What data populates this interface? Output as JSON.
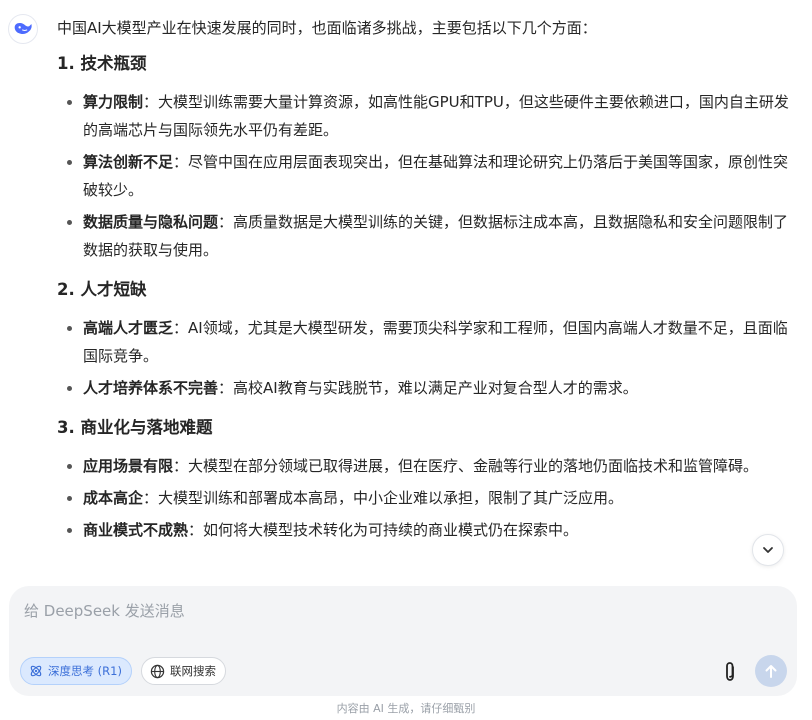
{
  "message": {
    "intro": "中国AI大模型产业在快速发展的同时，也面临诸多挑战，主要包括以下几个方面：",
    "sections": [
      {
        "title": "1. 技术瓶颈",
        "items": [
          {
            "label": "算力限制",
            "text": "：大模型训练需要大量计算资源，如高性能GPU和TPU，但这些硬件主要依赖进口，国内自主研发的高端芯片与国际领先水平仍有差距。"
          },
          {
            "label": "算法创新不足",
            "text": "：尽管中国在应用层面表现突出，但在基础算法和理论研究上仍落后于美国等国家，原创性突破较少。"
          },
          {
            "label": "数据质量与隐私问题",
            "text": "：高质量数据是大模型训练的关键，但数据标注成本高，且数据隐私和安全问题限制了数据的获取与使用。"
          }
        ]
      },
      {
        "title": "2. 人才短缺",
        "items": [
          {
            "label": "高端人才匮乏",
            "text": "：AI领域，尤其是大模型研发，需要顶尖科学家和工程师，但国内高端人才数量不足，且面临国际竞争。"
          },
          {
            "label": "人才培养体系不完善",
            "text": "：高校AI教育与实践脱节，难以满足产业对复合型人才的需求。"
          }
        ]
      },
      {
        "title": "3. 商业化与落地难题",
        "items": [
          {
            "label": "应用场景有限",
            "text": "：大模型在部分领域已取得进展，但在医疗、金融等行业的落地仍面临技术和监管障碍。"
          },
          {
            "label": "成本高企",
            "text": "：大模型训练和部署成本高昂，中小企业难以承担，限制了其广泛应用。"
          },
          {
            "label": "商业模式不成熟",
            "text": "：如何将大模型技术转化为可持续的商业模式仍在探索中。"
          }
        ]
      }
    ]
  },
  "composer": {
    "placeholder": "给 DeepSeek 发送消息",
    "deep_think_label": "深度思考 (R1)",
    "web_search_label": "联网搜索"
  },
  "footer": {
    "disclaimer": "内容由 AI 生成，请仔细甄别"
  },
  "icons": {
    "avatar": "deepseek-whale-icon",
    "scroll": "chevron-down-icon",
    "deep_think": "atom-icon",
    "web_search": "globe-icon",
    "attach": "paperclip-icon",
    "send": "arrow-up-icon"
  },
  "colors": {
    "accent": "#4d6bfe",
    "deep_think_bg": "#dbe9fe",
    "send_disabled": "#c8d6ec"
  }
}
